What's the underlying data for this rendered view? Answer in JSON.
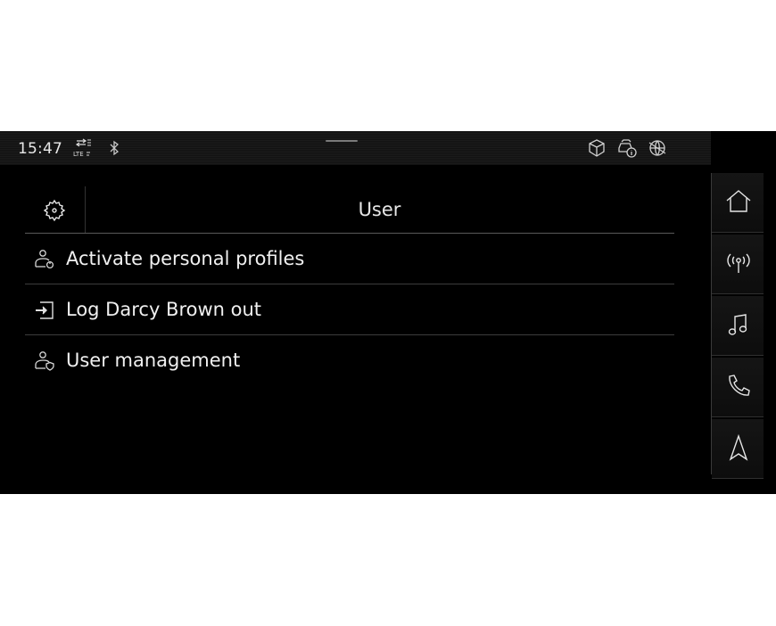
{
  "status_bar": {
    "time": "15:47",
    "icons": [
      "lte-signal-icon",
      "bluetooth-icon",
      "package-icon",
      "car-info-icon",
      "globe-icon"
    ]
  },
  "header": {
    "title": "User",
    "settings_icon": "gear-icon"
  },
  "menu": {
    "items": [
      {
        "label": "Activate personal profiles",
        "icon": "user-power-icon"
      },
      {
        "label": "Log Darcy Brown out",
        "icon": "logout-icon"
      },
      {
        "label": "User management",
        "icon": "user-shield-icon"
      }
    ]
  },
  "rail": {
    "items": [
      "home-icon",
      "radio-icon",
      "music-icon",
      "phone-icon",
      "navigation-icon"
    ]
  },
  "colors": {
    "background": "#000000",
    "text": "#f0f0f0",
    "divider": "#5a5a5a"
  }
}
